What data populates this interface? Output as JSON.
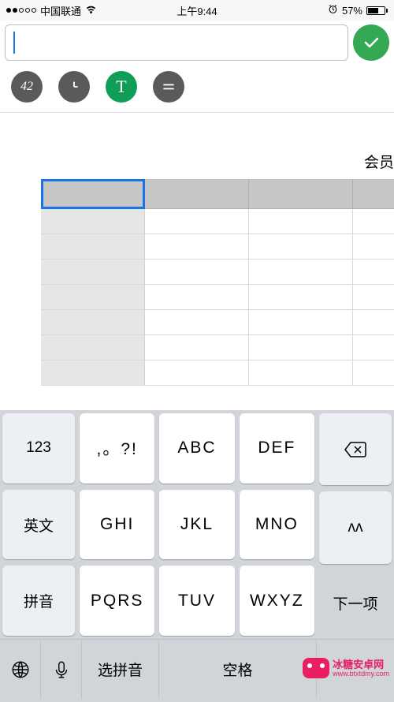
{
  "status": {
    "carrier": "中国联通",
    "time": "上午9:44",
    "battery_pct": "57%"
  },
  "formula": {
    "value": "",
    "placeholder": ""
  },
  "toolbar": {
    "btn_number": "42",
    "btn_clock": "",
    "btn_text": "T",
    "btn_menu": ""
  },
  "sheet": {
    "title_fragment": "会员",
    "cols": 4,
    "rows": 8
  },
  "keyboard": {
    "left": [
      "123",
      "英文",
      "拼音"
    ],
    "mid": [
      [
        ",。?!",
        "ABC",
        "DEF"
      ],
      [
        "GHI",
        "JKL",
        "MNO"
      ],
      [
        "PQRS",
        "TUV",
        "WXYZ"
      ]
    ],
    "right": {
      "backspace": "⌫",
      "reinput": "ᴧᴧ",
      "next": "下一项"
    },
    "bottom": {
      "globe": "",
      "mic": "",
      "select_pinyin": "选拼音",
      "space": "空格"
    }
  },
  "watermark": {
    "name": "冰糖安卓网",
    "url": "www.btxtdmy.com"
  }
}
